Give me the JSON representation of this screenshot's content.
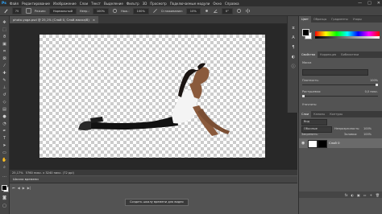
{
  "colors": {
    "accent": "#31a8ff",
    "chrome_dark": "#2f2f2f",
    "panel": "#535353",
    "workspace": "#282828"
  },
  "menubar": {
    "logo": "Ps",
    "items": [
      "Файл",
      "Редактирование",
      "Изображение",
      "Слои",
      "Текст",
      "Выделение",
      "Фильтр",
      "3D",
      "Просмотр",
      "Подключаемые модули",
      "Окно",
      "Справка"
    ],
    "window_buttons": [
      "—",
      "□",
      "✕"
    ]
  },
  "options_bar": {
    "brush_size": "75",
    "mode_label": "Режим:",
    "mode_value": "Нормальный",
    "opacity_label": "Непр.:",
    "opacity_value": "100%",
    "flow_label": "Наж.:",
    "flow_value": "100%",
    "smooth_label": "Сглаживание:",
    "smooth_value": "10%",
    "angle_value": "0°"
  },
  "document": {
    "tab_title": "photo-yoga.psd @ 25,1% (Слой 0, Слой-маска/8)",
    "close": "×"
  },
  "status": {
    "zoom": "25,17%",
    "doc_info": "5760 пикс. x 3240 пикс. (72 ppi)"
  },
  "timeline": {
    "title": "Шкала времени",
    "create_button": "Создать шкалу времени для видео",
    "controls": [
      "⏮",
      "◀",
      "▶",
      "▶|"
    ]
  },
  "right_panels": {
    "color_tabs": [
      "Цвет",
      "Образцы",
      "Градиенты",
      "Узоры"
    ],
    "properties_tabs": [
      "Свойства",
      "Коррекция",
      "Библиотеки"
    ],
    "mask_label": "Маска",
    "density_label": "Плотность:",
    "density_value": "100%",
    "feather_label": "Растушевка:",
    "feather_value": "0,0 пикс.",
    "refine_label": "Уточнить:",
    "layers_tabs": [
      "Слои",
      "Каналы",
      "Контуры"
    ],
    "search_placeholder": "Вид",
    "blend_mode": "Обычные",
    "opacity_label": "Непрозрачность:",
    "opacity_value": "100%",
    "lock_label": "Закрепить:",
    "fill_label": "Заливка:",
    "fill_value": "100%",
    "layer_name": "Слой 0",
    "footer_icons": [
      "fx",
      "◐",
      "▣",
      "▭",
      "+",
      "🗑"
    ]
  }
}
